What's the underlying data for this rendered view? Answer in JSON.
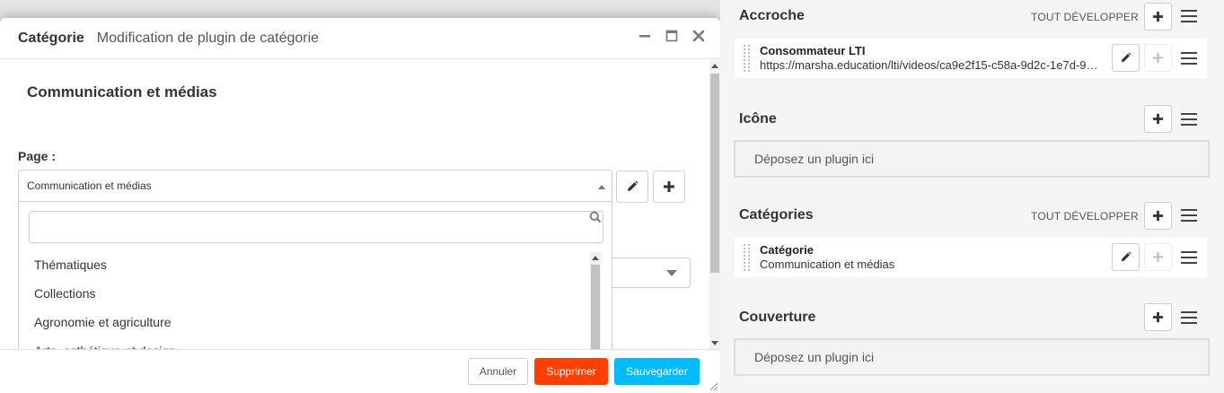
{
  "modal": {
    "title": "Catégorie",
    "subtitle": "Modification de plugin de catégorie",
    "controls": {
      "minimize_icon": "minimize-icon",
      "maximize_icon": "maximize-icon",
      "close_icon": "close-icon"
    },
    "heading": "Communication et médias",
    "page_label": "Page :",
    "page_select": {
      "value": "Communication et médias"
    },
    "search": {
      "placeholder": "",
      "value": ""
    },
    "dropdown_options": [
      "Thématiques",
      "Collections",
      "Agronomie et agriculture",
      "Arts, esthétique et design"
    ],
    "buttons": {
      "cancel": "Annuler",
      "delete": "Supprimer",
      "save": "Sauvegarder"
    },
    "colors": {
      "delete": "#ff4000",
      "save": "#00bbff"
    }
  },
  "right_panel": {
    "sections": {
      "accroche": {
        "title": "Accroche",
        "expand_all": "TOUT DÉVELOPPER",
        "plugin": {
          "name": "Consommateur LTI",
          "desc": "https://marsha.education/lti/videos/ca9e2f15-c58a-9d2c-1e7d-9c…"
        }
      },
      "icone": {
        "title": "Icône",
        "drop_zone": "Déposez un plugin ici"
      },
      "categories": {
        "title": "Catégories",
        "expand_all": "TOUT DÉVELOPPER",
        "plugin": {
          "name": "Catégorie",
          "desc": "Communication et médias"
        }
      },
      "couverture": {
        "title": "Couverture",
        "drop_zone": "Déposez un plugin ici"
      }
    }
  }
}
